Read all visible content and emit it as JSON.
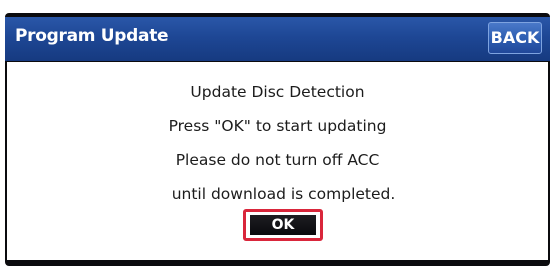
{
  "header": {
    "title": "Program Update",
    "back_label": "BACK"
  },
  "dialog": {
    "lines": [
      "Update Disc Detection",
      "Press \"OK\" to start updating",
      "Please do not turn off ACC",
      "until download is completed."
    ],
    "ok_label": "OK"
  },
  "colors": {
    "title_bar": "#1e4795",
    "highlight_border": "#d9263b",
    "screen_background": "#0b0b0e"
  }
}
